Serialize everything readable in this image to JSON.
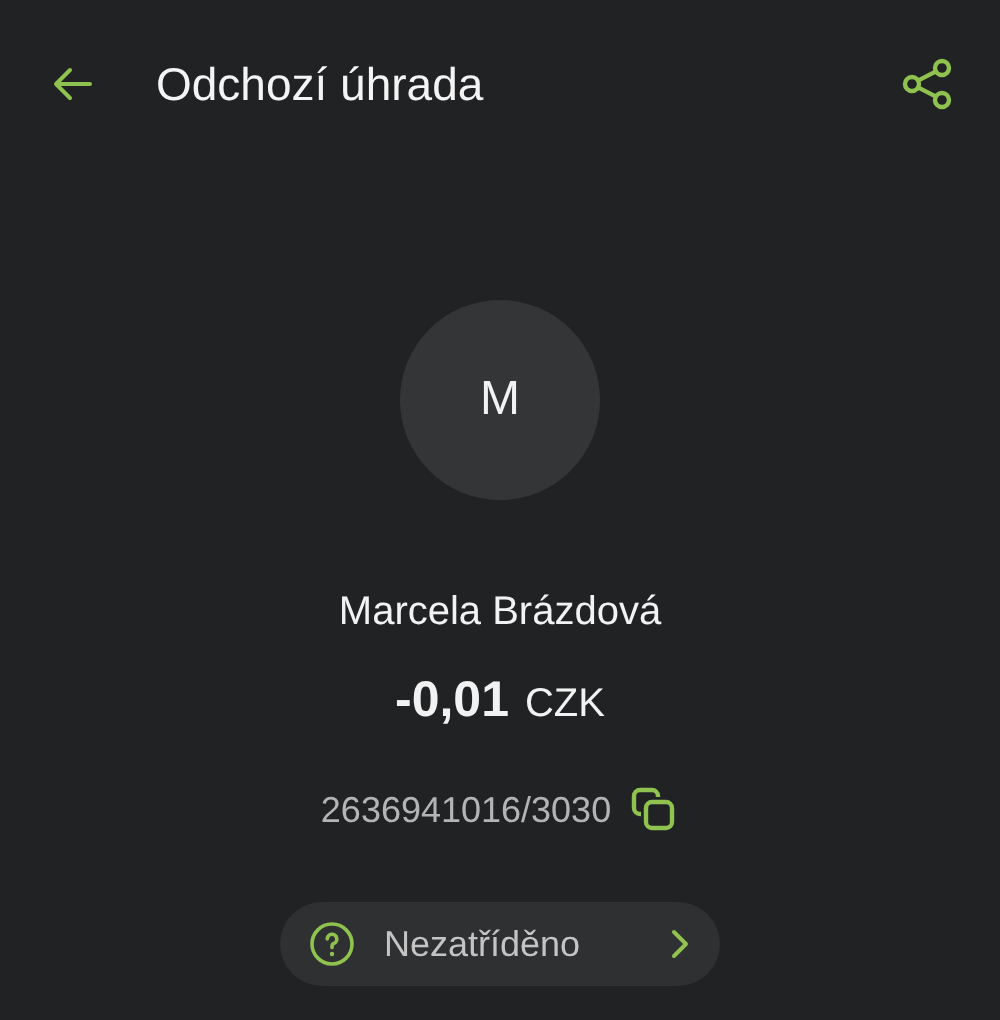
{
  "header": {
    "title": "Odchozí úhrada"
  },
  "counterparty": {
    "initial": "M",
    "name": "Marcela Brázdová"
  },
  "amount": {
    "value": "-0,01",
    "currency": "CZK"
  },
  "account": {
    "number": "2636941016/3030"
  },
  "category": {
    "label": "Nezatříděno"
  }
}
